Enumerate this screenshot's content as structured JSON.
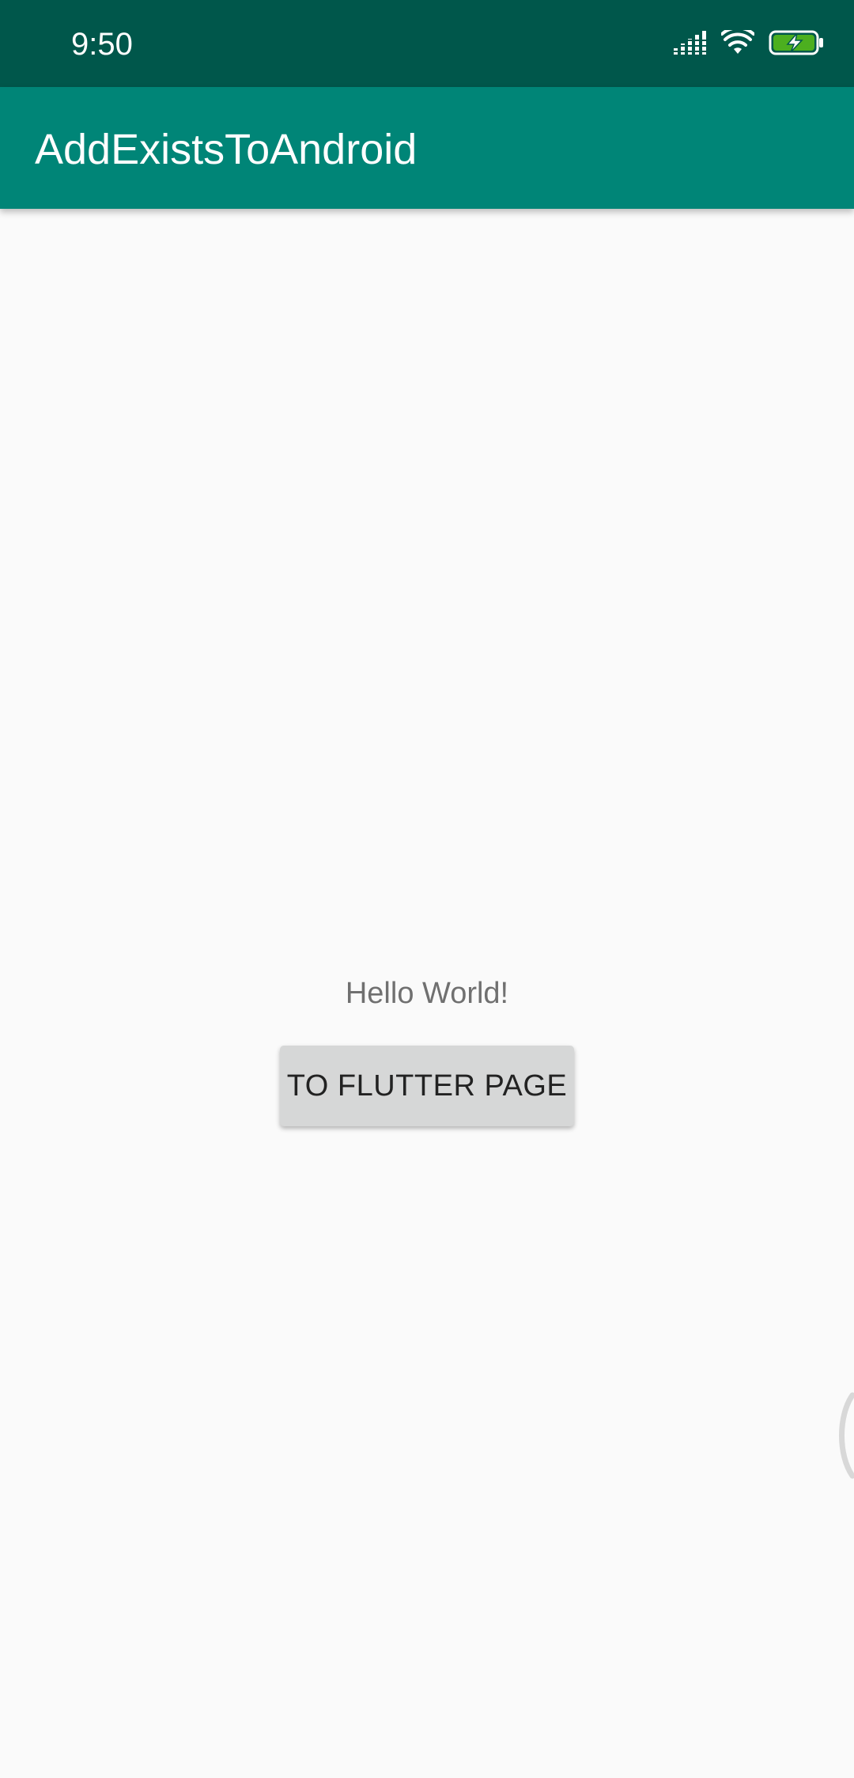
{
  "status_bar": {
    "time": "9:50",
    "icons": [
      "signal-icon",
      "wifi-icon",
      "battery-charging-icon"
    ],
    "color": "#00574b"
  },
  "app_bar": {
    "title": "AddExistsToAndroid",
    "color": "#008577"
  },
  "main": {
    "hello_text": "Hello World!",
    "button_label": "TO FLUTTER PAGE"
  },
  "colors": {
    "background": "#fafafa",
    "button": "#d6d7d7",
    "battery_fill": "#4caf1f"
  }
}
